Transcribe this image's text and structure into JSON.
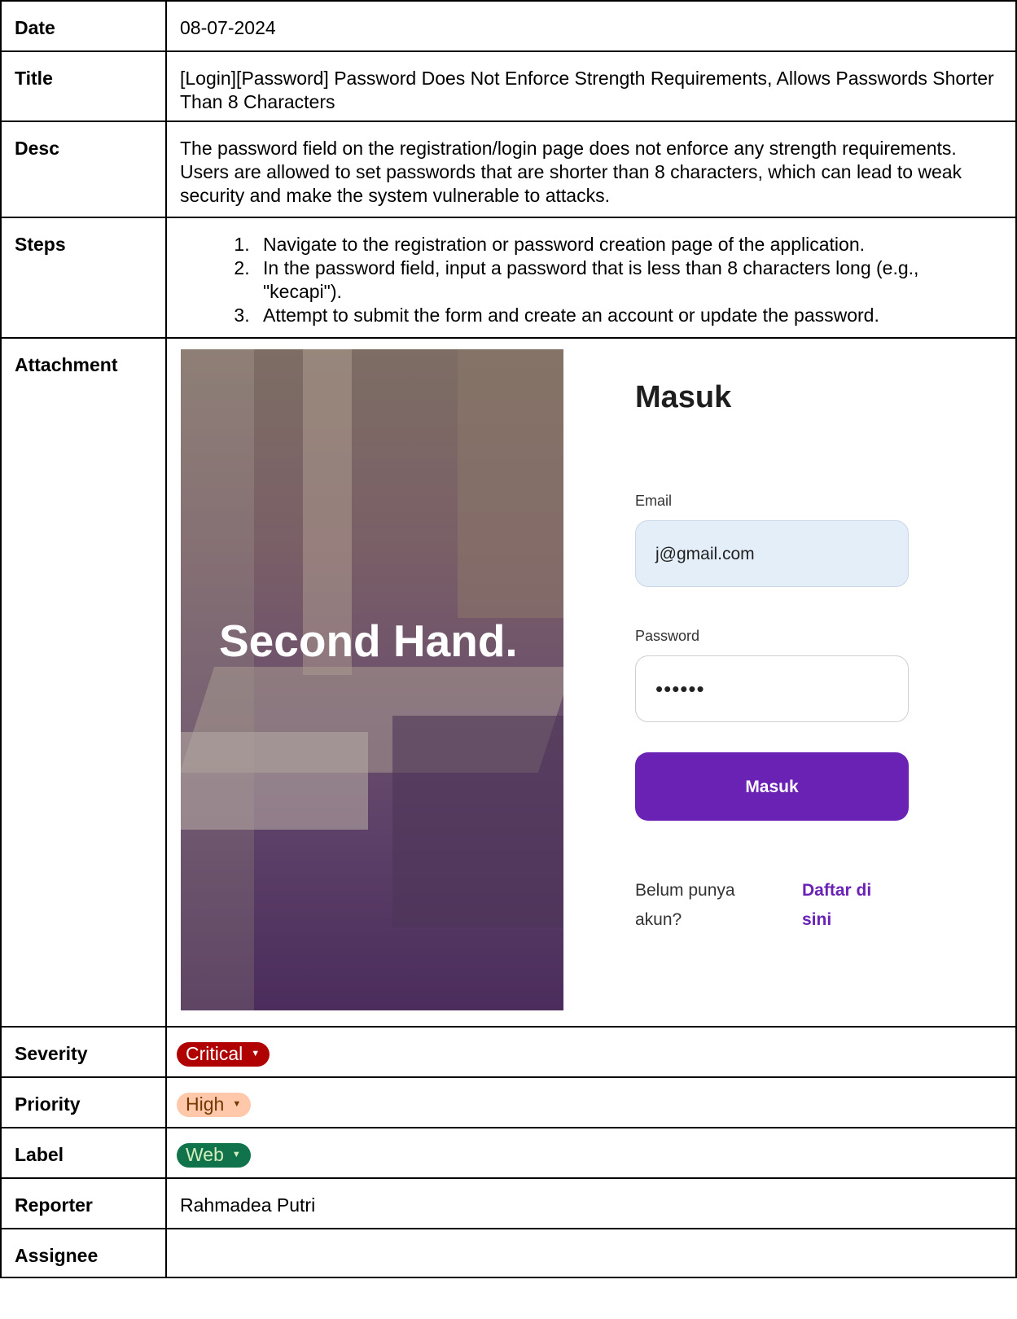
{
  "rows": {
    "date": {
      "label": "Date",
      "value": "08-07-2024"
    },
    "title": {
      "label": "Title",
      "value": "[Login][Password] Password Does Not Enforce Strength Requirements, Allows Passwords Shorter Than 8 Characters"
    },
    "desc": {
      "label": "Desc",
      "value": "The password field on the registration/login page does not enforce any strength requirements. Users are allowed to set passwords that are shorter than 8 characters, which can lead to weak security and make the system vulnerable to attacks."
    },
    "steps": {
      "label": "Steps",
      "items": [
        "Navigate to the registration or password creation page of the application.",
        "In the password field, input a password that is less than 8 characters long (e.g., \"kecapi\").",
        "Attempt to submit the form and create an account or update the password."
      ]
    },
    "attachment": {
      "label": "Attachment"
    },
    "severity": {
      "label": "Severity",
      "value": "Critical",
      "color": "#b10202"
    },
    "priority": {
      "label": "Priority",
      "value": "High",
      "color": "#ffc8aa"
    },
    "label": {
      "label": "Label",
      "value": "Web",
      "color": "#11734b"
    },
    "reporter": {
      "label": "Reporter",
      "value": "Rahmadea Putri"
    },
    "assignee": {
      "label": "Assignee",
      "value": ""
    }
  },
  "screenshot": {
    "brand": "Second Hand.",
    "heading": "Masuk",
    "email_label": "Email",
    "email_value": "j@gmail.com",
    "password_label": "Password",
    "password_value": "••••••",
    "submit_label": "Masuk",
    "register_prompt": "Belum punya akun?",
    "register_link": "Daftar di sini",
    "accent_color": "#6a22b5"
  }
}
